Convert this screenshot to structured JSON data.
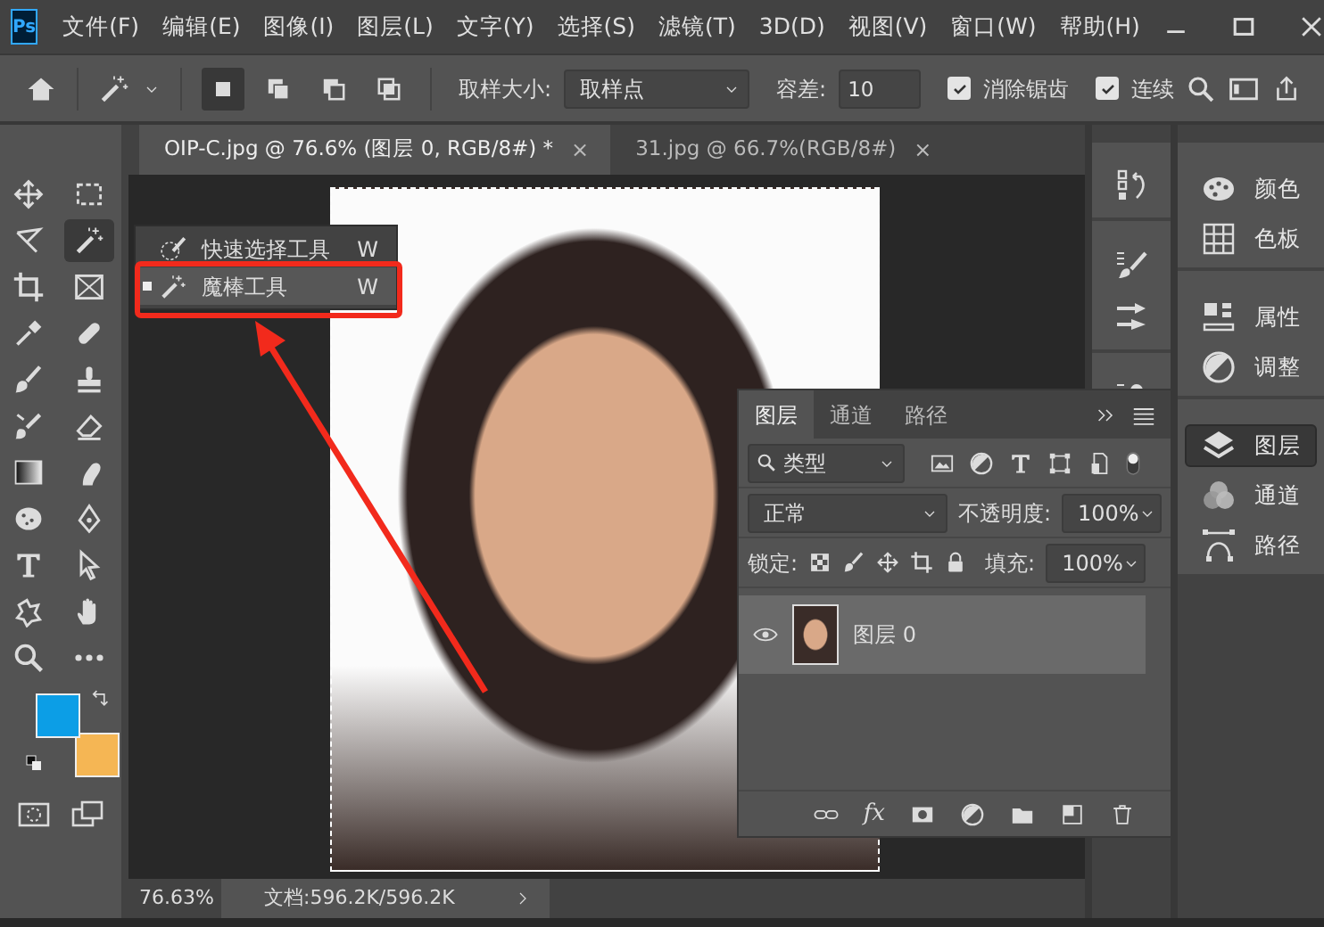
{
  "app_logo": "Ps",
  "menu": [
    "文件(F)",
    "编辑(E)",
    "图像(I)",
    "图层(L)",
    "文字(Y)",
    "选择(S)",
    "滤镜(T)",
    "3D(D)",
    "视图(V)",
    "窗口(W)",
    "帮助(H)"
  ],
  "options_bar": {
    "selection_modes": [
      {
        "kind": "new",
        "selected": true
      },
      {
        "kind": "add",
        "selected": false
      },
      {
        "kind": "subtract",
        "selected": false
      },
      {
        "kind": "intersect",
        "selected": false
      }
    ],
    "sample_size_label": "取样大小:",
    "sample_size": "取样点",
    "tolerance_label": "容差:",
    "tolerance": "10",
    "checkboxes": [
      {
        "label": "消除锯齿",
        "checked": true
      },
      {
        "label": "连续",
        "checked": true
      }
    ]
  },
  "document_tabs": [
    {
      "label": "OIP-C.jpg @ 76.6% (图层 0, RGB/8#) *",
      "close": "×",
      "selected": true
    },
    {
      "label": "31.jpg @ 66.7%(RGB/8#)",
      "close": "×",
      "selected": false
    }
  ],
  "tools": [
    {
      "kind": "move",
      "selected": false
    },
    {
      "kind": "marquee",
      "selected": false
    },
    {
      "kind": "lasso",
      "selected": false
    },
    {
      "kind": "wand",
      "selected": true
    },
    {
      "kind": "crop",
      "selected": false
    },
    {
      "kind": "frame",
      "selected": false
    },
    {
      "kind": "eyedropper",
      "selected": false
    },
    {
      "kind": "bandage",
      "selected": false
    },
    {
      "kind": "brush",
      "selected": false
    },
    {
      "kind": "stamp",
      "selected": false
    },
    {
      "kind": "history",
      "selected": false
    },
    {
      "kind": "eraser",
      "selected": false
    },
    {
      "kind": "gradient",
      "selected": false
    },
    {
      "kind": "smudge",
      "selected": false
    },
    {
      "kind": "sponge",
      "selected": false
    },
    {
      "kind": "pen",
      "selected": false
    },
    {
      "kind": "type",
      "selected": false
    },
    {
      "kind": "pointer",
      "selected": false
    },
    {
      "kind": "shape",
      "selected": false
    },
    {
      "kind": "hand",
      "selected": false
    },
    {
      "kind": "zoom",
      "selected": false
    },
    {
      "kind": "more",
      "selected": false
    }
  ],
  "swatches": [
    {
      "kind": "foreground",
      "color": "#0c9ee6"
    },
    {
      "kind": "background",
      "color": "#f5b654"
    }
  ],
  "tool_flyout": {
    "items": [
      {
        "kind": "quick-select",
        "label": "快速选择工具",
        "shortcut": "W",
        "selected": false
      },
      {
        "kind": "wand",
        "label": "魔棒工具",
        "shortcut": "W",
        "selected": true
      }
    ]
  },
  "status_bar": {
    "zoom": "76.63%",
    "document": "文档:596.2K/596.2K"
  },
  "dock": {
    "groups": [
      {
        "items": [
          {
            "kind": "color",
            "label": "颜色",
            "selected": false
          },
          {
            "kind": "swatches",
            "label": "色板",
            "selected": false
          }
        ]
      },
      {
        "items": [
          {
            "kind": "properties",
            "label": "属性",
            "selected": false
          },
          {
            "kind": "adjust",
            "label": "调整",
            "selected": false
          }
        ]
      },
      {
        "items": [
          {
            "kind": "layers",
            "label": "图层",
            "selected": true
          },
          {
            "kind": "channels",
            "label": "通道",
            "selected": false
          },
          {
            "kind": "paths",
            "label": "路径",
            "selected": false
          }
        ]
      }
    ]
  },
  "layers_panel": {
    "tabs": [
      {
        "label": "图层",
        "selected": true
      },
      {
        "label": "通道",
        "selected": false
      },
      {
        "label": "路径",
        "selected": false
      }
    ],
    "filter": "类型",
    "blend_mode": "正常",
    "opacity_label": "不透明度:",
    "opacity": "100%",
    "lock_label": "锁定:",
    "fill_label": "填充:",
    "fill": "100%",
    "effects_button": "fx",
    "layers": [
      {
        "name": "图层 0",
        "visible": true,
        "selected": true
      }
    ]
  }
}
